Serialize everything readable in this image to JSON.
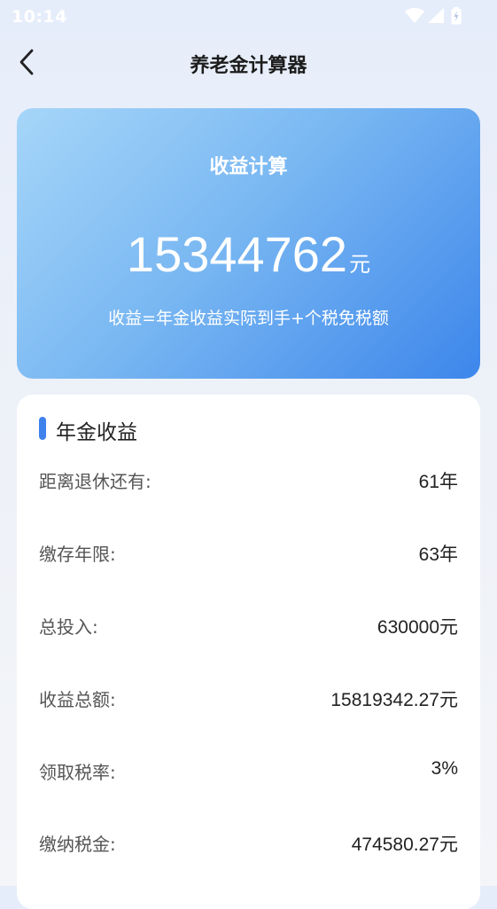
{
  "status_bar": {
    "time": "10:14",
    "icons": [
      "wifi-icon",
      "signal-icon",
      "battery-charging-icon"
    ]
  },
  "header": {
    "title": "养老金计算器",
    "back_icon": "chevron-left-icon"
  },
  "hero": {
    "title": "收益计算",
    "amount": "15344762",
    "unit": "元",
    "formula": "收益=年金收益实际到手+个税免税额",
    "gradient": [
      "#a6d6f9",
      "#3d86eb"
    ]
  },
  "details": {
    "section_title": "年金收益",
    "accent_color": "#3f82ec",
    "rows": [
      {
        "label": "距离退休还有:",
        "value": "61年"
      },
      {
        "label": "缴存年限:",
        "value": "63年"
      },
      {
        "label": "总投入:",
        "value": "630000元"
      },
      {
        "label": "收益总额:",
        "value": "15819342.27元"
      },
      {
        "label": "领取税率:",
        "value": "3%"
      },
      {
        "label": "缴纳税金:",
        "value": "474580.27元"
      }
    ]
  }
}
